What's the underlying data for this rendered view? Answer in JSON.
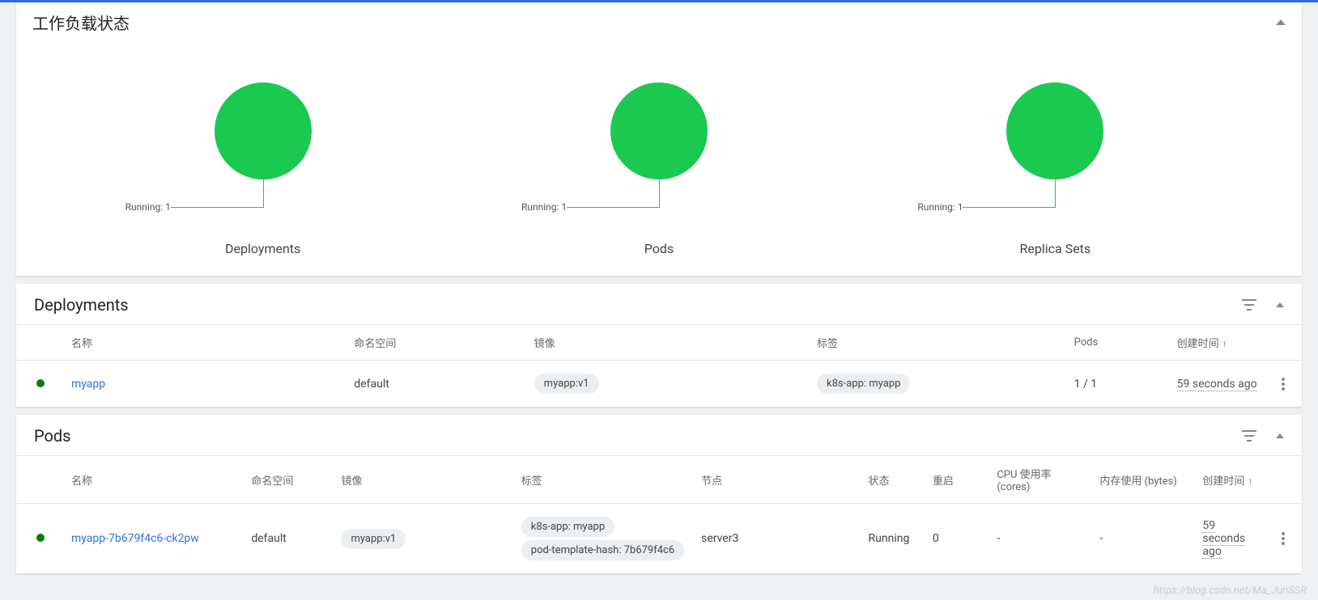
{
  "status": {
    "title": "工作负载状态",
    "charts": [
      {
        "label": "Running: 1",
        "title": "Deployments"
      },
      {
        "label": "Running: 1",
        "title": "Pods"
      },
      {
        "label": "Running: 1",
        "title": "Replica Sets"
      }
    ]
  },
  "chart_data": [
    {
      "type": "pie",
      "title": "Deployments",
      "categories": [
        "Running"
      ],
      "values": [
        1
      ]
    },
    {
      "type": "pie",
      "title": "Pods",
      "categories": [
        "Running"
      ],
      "values": [
        1
      ]
    },
    {
      "type": "pie",
      "title": "Replica Sets",
      "categories": [
        "Running"
      ],
      "values": [
        1
      ]
    }
  ],
  "deployments": {
    "title": "Deployments",
    "headers": {
      "name": "名称",
      "namespace": "命名空间",
      "image": "镜像",
      "labels": "标签",
      "pods": "Pods",
      "created": "创建时间"
    },
    "rows": [
      {
        "status": "running",
        "name": "myapp",
        "namespace": "default",
        "images": [
          "myapp:v1"
        ],
        "labels": [
          "k8s-app: myapp"
        ],
        "pods": "1 / 1",
        "created": "59 seconds ago"
      }
    ]
  },
  "pods": {
    "title": "Pods",
    "headers": {
      "name": "名称",
      "namespace": "命名空间",
      "image": "镜像",
      "labels": "标签",
      "node": "节点",
      "status": "状态",
      "restarts": "重启",
      "cpu": "CPU 使用率 (cores)",
      "memory": "内存使用 (bytes)",
      "created": "创建时间"
    },
    "rows": [
      {
        "statusDot": "running",
        "name": "myapp-7b679f4c6-ck2pw",
        "namespace": "default",
        "images": [
          "myapp:v1"
        ],
        "labels": [
          "k8s-app: myapp",
          "pod-template-hash: 7b679f4c6"
        ],
        "node": "server3",
        "status": "Running",
        "restarts": "0",
        "cpu": "-",
        "memory": "-",
        "created": "59 seconds ago"
      }
    ]
  },
  "watermark": "https://blog.csdn.net/Ma_JunSSR"
}
